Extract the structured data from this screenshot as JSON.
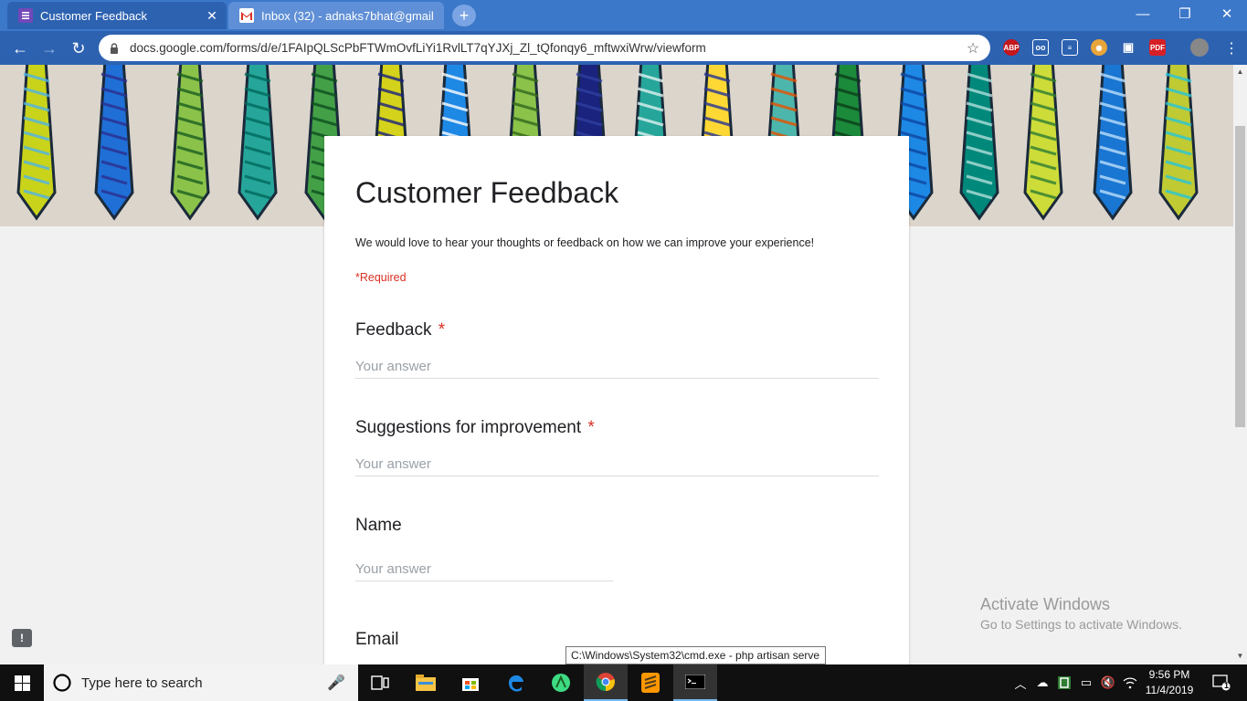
{
  "browser": {
    "tabs": [
      {
        "title": "Customer Feedback",
        "icon": "google-forms-icon",
        "active": true
      },
      {
        "title": "Inbox (32) - adnaks7bhat@gmail",
        "icon": "gmail-icon",
        "active": false
      }
    ],
    "url": "docs.google.com/forms/d/e/1FAIpQLScPbFTWmOvfLiYi1RvlLT7qYJXj_Zl_tQfonqy6_mftwxiWrw/viewform",
    "extensions": [
      {
        "name": "adblock-plus-icon",
        "label": "ABP"
      },
      {
        "name": "extension-glasses-icon",
        "label": ""
      },
      {
        "name": "extension-notes-icon",
        "label": ""
      },
      {
        "name": "extension-owl-icon",
        "label": ""
      },
      {
        "name": "extension-camera-icon",
        "label": ""
      },
      {
        "name": "extension-pdf-icon",
        "label": "PDF"
      }
    ]
  },
  "form": {
    "title": "Customer Feedback",
    "description": "We would love to hear your thoughts or feedback on how we can improve your experience!",
    "required_note": "*Required",
    "questions": [
      {
        "label": "Feedback",
        "required": true,
        "placeholder": "Your answer"
      },
      {
        "label": "Suggestions for improvement",
        "required": true,
        "placeholder": "Your answer"
      },
      {
        "label": "Name",
        "required": false,
        "placeholder": "Your answer"
      },
      {
        "label": "Email",
        "required": false,
        "placeholder": ""
      }
    ],
    "required_star": "*"
  },
  "tooltip": "C:\\Windows\\System32\\cmd.exe - php  artisan serve",
  "watermark": {
    "line1": "Activate Windows",
    "line2": "Go to Settings to activate Windows."
  },
  "taskbar": {
    "search_placeholder": "Type here to search",
    "time": "9:56 PM",
    "date": "11/4/2019",
    "notification_count": "1"
  },
  "colors": {
    "chrome_frame": "#3c78c9",
    "required_red": "#d93025",
    "forms_purple": "#673ab7"
  }
}
